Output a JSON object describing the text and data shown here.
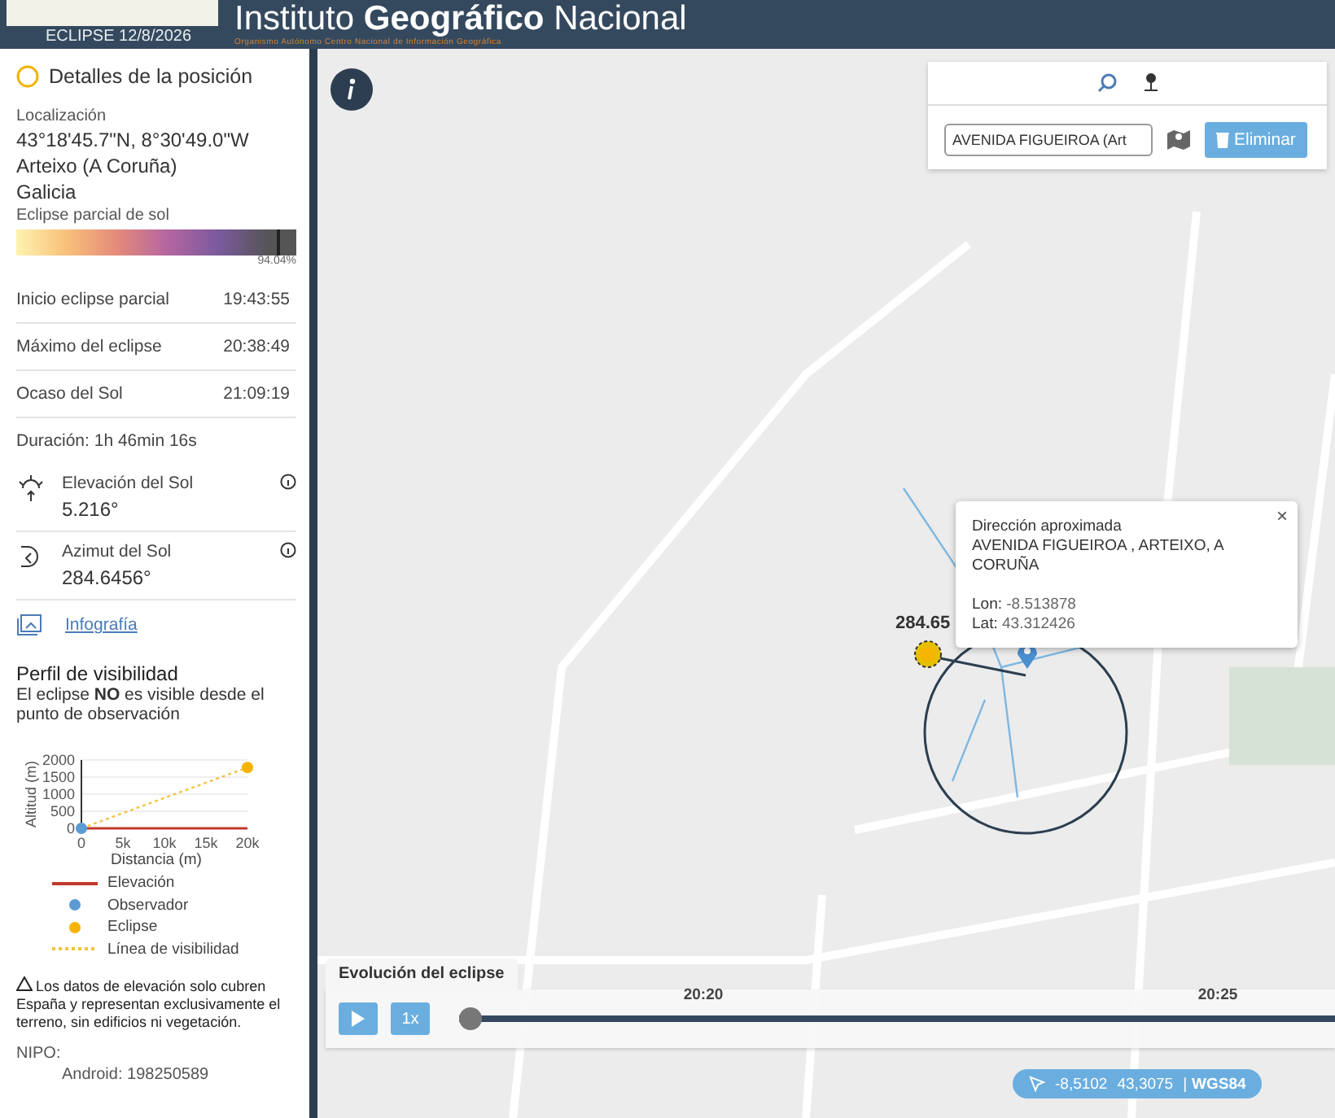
{
  "header": {
    "title_parts": [
      "Instituto ",
      "Geográfico",
      " Nacional"
    ],
    "subtitle": "Organismo Autónomo   Centro Nacional de Información Geográfica",
    "event": "ECLIPSE 12/8/2026"
  },
  "sidebar": {
    "title": "Detalles de la posición",
    "location_label": "Localización",
    "coordinates": "43°18'45.7\"N, 8°30'49.0\"W",
    "place": "Arteixo (A Coruña)",
    "region": "Galicia",
    "eclipse_type": "Eclipse parcial de sol",
    "magnitude": {
      "level": 0.9404,
      "reading": "94.04%"
    },
    "times": [
      {
        "label": "Inicio eclipse parcial",
        "value": "19:43:55"
      },
      {
        "label": "Máximo del eclipse",
        "value": "20:38:49"
      },
      {
        "label": "Ocaso del Sol",
        "value": "21:09:19"
      }
    ],
    "duration": "Duración: 1h 46min 16s",
    "sun": [
      {
        "kind": "elevation",
        "label": "Elevación del Sol",
        "value": "5.216°"
      },
      {
        "kind": "azimuth",
        "label": "Azimut del Sol",
        "value": "284.6456°"
      }
    ],
    "infographic_link": "Infografía",
    "profile": {
      "title": "Perfil de visibilidad",
      "text": "El eclipse **NO** es visible desde el punto de observación",
      "chart_data": {
        "type": "line",
        "grid": true,
        "xlabel": "Distancia (m)",
        "ylabel": "Altitud (m)",
        "x": [
          0,
          20000
        ],
        "xlim": [
          0,
          20000
        ],
        "ylim": [
          0,
          2000
        ],
        "xticks": [
          {
            "value": 0,
            "label": "0"
          },
          {
            "value": 5000,
            "label": "5k"
          },
          {
            "value": 10000,
            "label": "10k"
          },
          {
            "value": 15000,
            "label": "15k"
          },
          {
            "value": 20000,
            "label": "20k"
          }
        ],
        "yticks": [
          0,
          500,
          1000,
          1500,
          2000
        ],
        "series": [
          {
            "name": "Elevación",
            "color": "#c0392b",
            "values": [
              0,
              0
            ]
          },
          {
            "name": "Observador",
            "color": "#5b9bd5",
            "marker": "circle",
            "values": [
              0,
              null
            ]
          },
          {
            "name": "Eclipse",
            "color": "#f5b400",
            "marker": "circle",
            "values": [
              null,
              1780
            ]
          },
          {
            "name": "Línea de visibilidad",
            "color": "#f5c242",
            "line_style": "dashed",
            "values": [
              0,
              1780
            ]
          }
        ]
      }
    },
    "note": "Los datos de elevación solo cubren España y representan exclusivamente el terreno, sin edificios ni vegetación.",
    "nipo": "NIPO:",
    "android": "Android: 198250589"
  },
  "search_panel": {
    "input_value": "AVENIDA FIGUEIROA (Art",
    "delete_button": "Eliminar"
  },
  "popup": {
    "title": "Dirección aproximada",
    "address": "AVENIDA FIGUEIROA , ARTEIXO, A CORUÑA",
    "close": "×",
    "lon_label": "Lon:",
    "lon": "-8.513878",
    "lat_label": "Lat:",
    "lat": "43.312426"
  },
  "sun_marker": {
    "label": "284.65"
  },
  "timeline": {
    "title": "Evolución del eclipse",
    "speed": "1x",
    "ticks": [
      "20:20",
      "20:25"
    ],
    "level": 0.0
  },
  "coords_pill": {
    "lon": "-8,5102",
    "lat": "43,3075",
    "separator": "|",
    "crs": "WGS84"
  }
}
